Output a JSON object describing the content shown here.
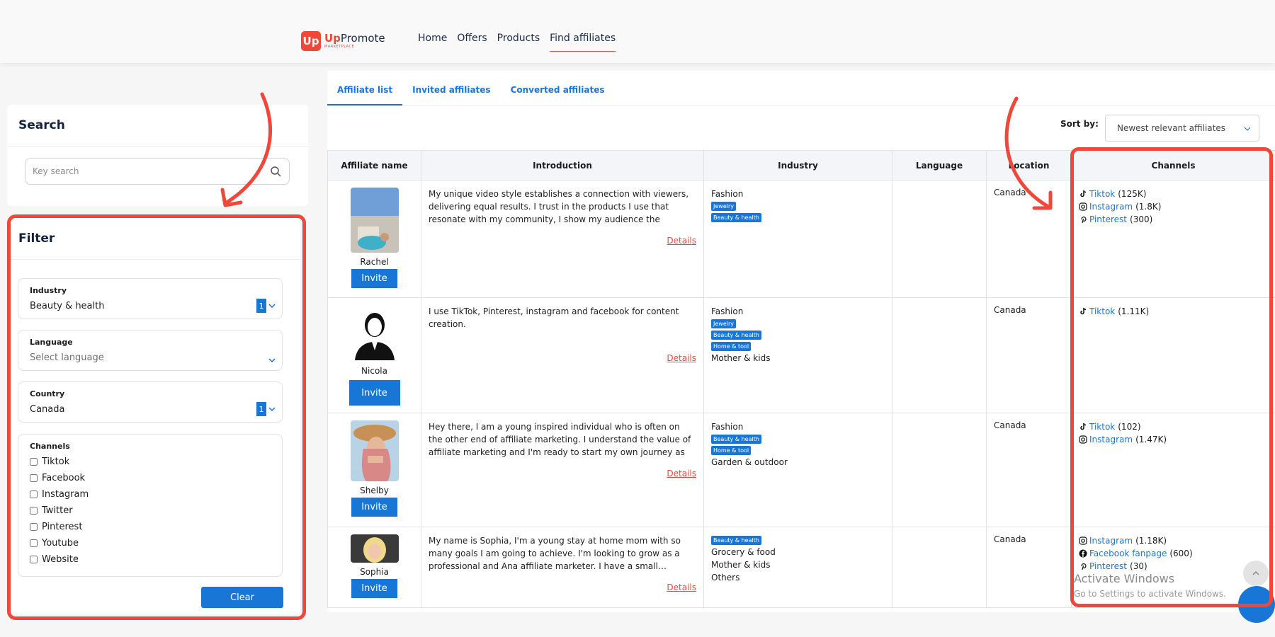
{
  "brand": {
    "name_up": "Up",
    "name_rest": "Promote",
    "sub": "MARKETPLACE",
    "mark": "Up",
    "accent": "#f0473b",
    "primary": "#1877d6"
  },
  "nav": [
    {
      "label": "Home"
    },
    {
      "label": "Offers"
    },
    {
      "label": "Products"
    },
    {
      "label": "Find affiliates",
      "active": true
    }
  ],
  "search": {
    "title": "Search",
    "placeholder": "Key search",
    "icon": "search-icon"
  },
  "filter": {
    "title": "Filter",
    "industry": {
      "label": "Industry",
      "value": "Beauty & health",
      "count": "1"
    },
    "language": {
      "label": "Language",
      "placeholder": "Select language"
    },
    "country": {
      "label": "Country",
      "value": "Canada",
      "count": "1"
    },
    "channels": {
      "label": "Channels",
      "options": [
        "Tiktok",
        "Facebook",
        "Instagram",
        "Twitter",
        "Pinterest",
        "Youtube",
        "Website"
      ]
    },
    "clear_label": "Clear"
  },
  "tabs": [
    {
      "label": "Affiliate list",
      "active": true
    },
    {
      "label": "Invited affiliates"
    },
    {
      "label": "Converted affiliates"
    }
  ],
  "sort": {
    "label": "Sort by:",
    "value": "Newest relevant affiliates"
  },
  "table": {
    "headers": [
      "Affiliate name",
      "Introduction",
      "Industry",
      "Language",
      "Location",
      "Channels"
    ],
    "invite_label": "Invite",
    "details_label": "Details",
    "rows": [
      {
        "name": "Rachel",
        "intro": "My unique video style establishes a connection with viewers, delivering equal results. I trust in the products I use that resonate with my community, I show my audience the results…",
        "industry_text": "Fashion",
        "tags": [
          "Jewelry",
          "Beauty & health"
        ],
        "industry_after": "",
        "location": "Canada",
        "channels": [
          {
            "icon": "tiktok-icon",
            "name": "Tiktok",
            "count": "(125K)"
          },
          {
            "icon": "instagram-icon",
            "name": "Instagram",
            "count": "(1.8K)"
          },
          {
            "icon": "pinterest-icon",
            "name": "Pinterest",
            "count": "(300)"
          }
        ]
      },
      {
        "name": "Nicola",
        "intro": "I use TikTok, Pinterest, instagram and facebook for content creation.",
        "industry_text": "Fashion",
        "tags": [
          "Jewelry",
          "Beauty & health",
          "Home & tool"
        ],
        "industry_after": "Mother & kids",
        "location": "Canada",
        "channels": [
          {
            "icon": "tiktok-icon",
            "name": "Tiktok",
            "count": "(1.11K)"
          }
        ]
      },
      {
        "name": "Shelby",
        "intro": "Hey there, I am a young inspired individual who is often on the other end of affiliate marketing. I understand the value of affiliate marketing and I'm ready to start my own journey as a…",
        "industry_text": "Fashion",
        "tags": [
          "Beauty & health",
          "Home & tool"
        ],
        "industry_after": "Garden & outdoor",
        "location": "Canada",
        "channels": [
          {
            "icon": "tiktok-icon",
            "name": "Tiktok",
            "count": "(102)"
          },
          {
            "icon": "instagram-icon",
            "name": "Instagram",
            "count": "(1.47K)"
          }
        ]
      },
      {
        "name": "Sophia",
        "intro": "My name is Sophia, I'm a young stay at home mom with so many goals I am going to achieve. I'm looking to grow as a professional and Ana affiliate marketer. I have a small…",
        "industry_text": "",
        "tags": [
          "Beauty & health"
        ],
        "industry_after": "Grocery & food",
        "industry_after2": "Mother & kids",
        "industry_after3": "Others",
        "location": "Canada",
        "channels": [
          {
            "icon": "instagram-icon",
            "name": "Instagram",
            "count": "(1.18K)"
          },
          {
            "icon": "facebook-icon",
            "name": "Facebook fanpage",
            "count": "(600)"
          },
          {
            "icon": "pinterest-icon",
            "name": "Pinterest",
            "count": "(30)"
          }
        ]
      }
    ]
  },
  "watermark": {
    "title": "Activate Windows",
    "sub": "Go to Settings to activate Windows."
  }
}
